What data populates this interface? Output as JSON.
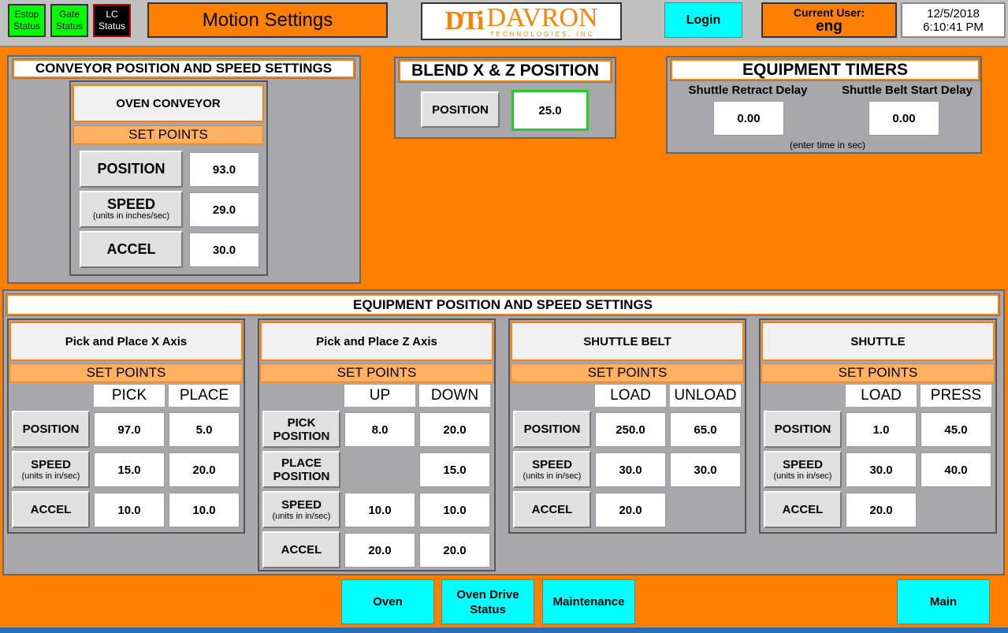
{
  "header": {
    "estop": {
      "line1": "Estop",
      "line2": "Status",
      "color": "#00ff00"
    },
    "gate": {
      "line1": "Gate",
      "line2": "Status",
      "color": "#00ff00"
    },
    "lc": {
      "line1": "LC",
      "line2": "Status",
      "color": "#000000"
    },
    "title": "Motion Settings",
    "logo": {
      "mark": "DTi",
      "name": "DAVRON",
      "sub": "TECHNOLOGIES, INC"
    },
    "login_label": "Login",
    "current_user_label": "Current User:",
    "current_user": "eng",
    "date": "12/5/2018",
    "time": "6:10:41 PM"
  },
  "conveyor": {
    "title": "CONVEYOR POSITION AND SPEED SETTINGS",
    "name": "OVEN CONVEYOR",
    "set_points": "SET POINTS",
    "rows": [
      {
        "label": "POSITION",
        "sub": "",
        "value": "93.0"
      },
      {
        "label": "SPEED",
        "sub": "(units in inches/sec)",
        "value": "29.0"
      },
      {
        "label": "ACCEL",
        "sub": "",
        "value": "30.0"
      }
    ]
  },
  "blend": {
    "title": "BLEND X & Z POSITION",
    "label": "POSITION",
    "value": "25.0"
  },
  "timers": {
    "title": "EQUIPMENT TIMERS",
    "retract_label": "Shuttle Retract Delay",
    "retract_value": "0.00",
    "belt_label": "Shuttle Belt Start Delay",
    "belt_value": "0.00",
    "note": "(enter time in sec)"
  },
  "equipment": {
    "title": "EQUIPMENT POSITION AND SPEED SETTINGS",
    "xaxis": {
      "name": "Pick and Place X Axis",
      "set_points": "SET POINTS",
      "col1": "PICK",
      "col2": "PLACE",
      "position_label": "POSITION",
      "position": [
        "97.0",
        "5.0"
      ],
      "speed_label": "SPEED",
      "speed_sub": "(units in in/sec)",
      "speed": [
        "15.0",
        "20.0"
      ],
      "accel_label": "ACCEL",
      "accel": [
        "10.0",
        "10.0"
      ]
    },
    "zaxis": {
      "name": "Pick and Place Z Axis",
      "set_points": "SET POINTS",
      "col1": "UP",
      "col2": "DOWN",
      "pick_label1": "PICK",
      "pick_label2": "POSITION",
      "pick": [
        "8.0",
        "20.0"
      ],
      "place_label1": "PLACE",
      "place_label2": "POSITION",
      "place": "15.0",
      "speed_label": "SPEED",
      "speed_sub": "(units in in/sec)",
      "speed": [
        "10.0",
        "10.0"
      ],
      "accel_label": "ACCEL",
      "accel": [
        "20.0",
        "20.0"
      ]
    },
    "belt": {
      "name": "SHUTTLE BELT",
      "set_points": "SET POINTS",
      "col1": "LOAD",
      "col2": "UNLOAD",
      "position_label": "POSITION",
      "position": [
        "250.0",
        "65.0"
      ],
      "speed_label": "SPEED",
      "speed_sub": "(units in in/sec)",
      "speed": [
        "30.0",
        "30.0"
      ],
      "accel_label": "ACCEL",
      "accel": "20.0"
    },
    "shuttle": {
      "name": "SHUTTLE",
      "set_points": "SET POINTS",
      "col1": "LOAD",
      "col2": "PRESS",
      "position_label": "POSITION",
      "position": [
        "1.0",
        "45.0"
      ],
      "speed_label": "SPEED",
      "speed_sub": "(units in in/sec)",
      "speed": [
        "30.0",
        "40.0"
      ],
      "accel_label": "ACCEL",
      "accel": "20.0"
    }
  },
  "nav": {
    "oven": "Oven",
    "drive_line1": "Oven Drive",
    "drive_line2": "Status",
    "maintenance": "Maintenance",
    "main": "Main"
  },
  "colors": {
    "accent": "#ff8000",
    "panel": "#a8a8ac",
    "button": "#00ffff",
    "status_ok": "#00ff00"
  }
}
